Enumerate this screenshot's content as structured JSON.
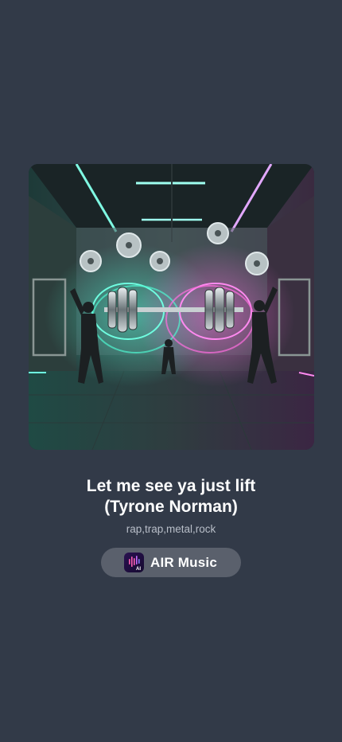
{
  "song": {
    "title_line1": "Let me see ya just lift",
    "title_line2": "(Tyrone Norman)",
    "genres": "rap,trap,metal,rock"
  },
  "brand": {
    "name": "AIR Music",
    "logo_icon": "waveform-ai-logo-icon",
    "logo_text": "AI"
  },
  "colors": {
    "background": "#323a48",
    "pill": "#5a606c",
    "neon_teal": "#4ff5d0",
    "neon_pink": "#ff6ee0"
  }
}
